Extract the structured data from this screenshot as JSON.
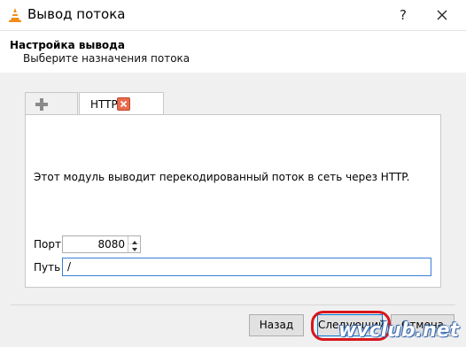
{
  "window": {
    "title": "Вывод потока",
    "help_glyph": "?",
    "icon": "vlc-cone-icon"
  },
  "header": {
    "title": "Настройка вывода",
    "subtitle": "Выберите назначения потока"
  },
  "tabs": {
    "add_icon": "plus-icon",
    "items": [
      {
        "label": "HTTP",
        "close_icon": "close-tab-icon"
      }
    ]
  },
  "panel": {
    "description": "Этот модуль выводит перекодированный поток в сеть через HTTP.",
    "port_label": "Порт",
    "port_value": "8080",
    "path_label": "Путь",
    "path_value": "/"
  },
  "buttons": {
    "back": "Назад",
    "next": "Следующий",
    "cancel": "Отмена"
  },
  "watermark": "wvclub.net",
  "colors": {
    "highlight_ring": "#d8161c",
    "tab_close": "#e96b4e",
    "focus_border": "#3c7fd6"
  }
}
